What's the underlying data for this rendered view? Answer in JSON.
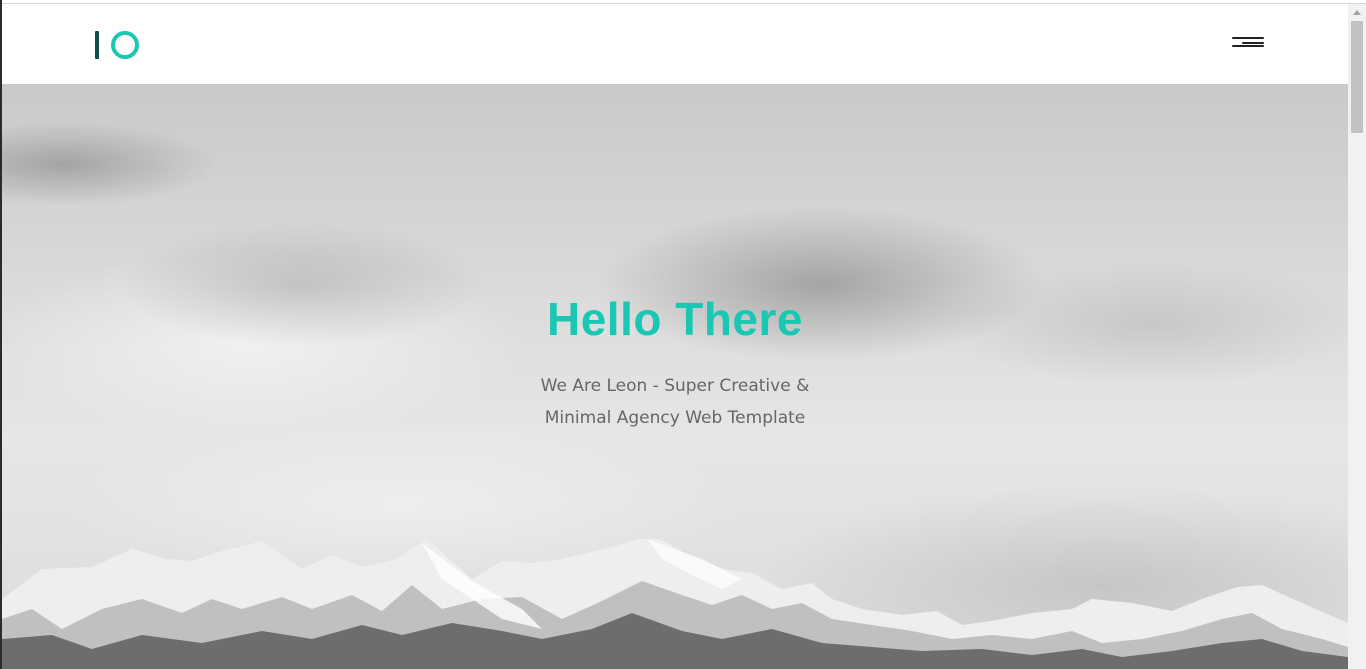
{
  "header": {
    "logo_name": "logo",
    "menu_icon": "hamburger-menu-icon"
  },
  "hero": {
    "title": "Hello There",
    "subtitle": "We Are Leon - Super Creative & Minimal Agency Web Template",
    "background": "black-and-white mountain landscape under cloudy sky"
  },
  "colors": {
    "accent": "#1ac7b3",
    "logo_bar": "#0f4d4d",
    "subtitle_text": "#666666"
  },
  "scrollbar": {
    "position_fraction": 0.0
  }
}
